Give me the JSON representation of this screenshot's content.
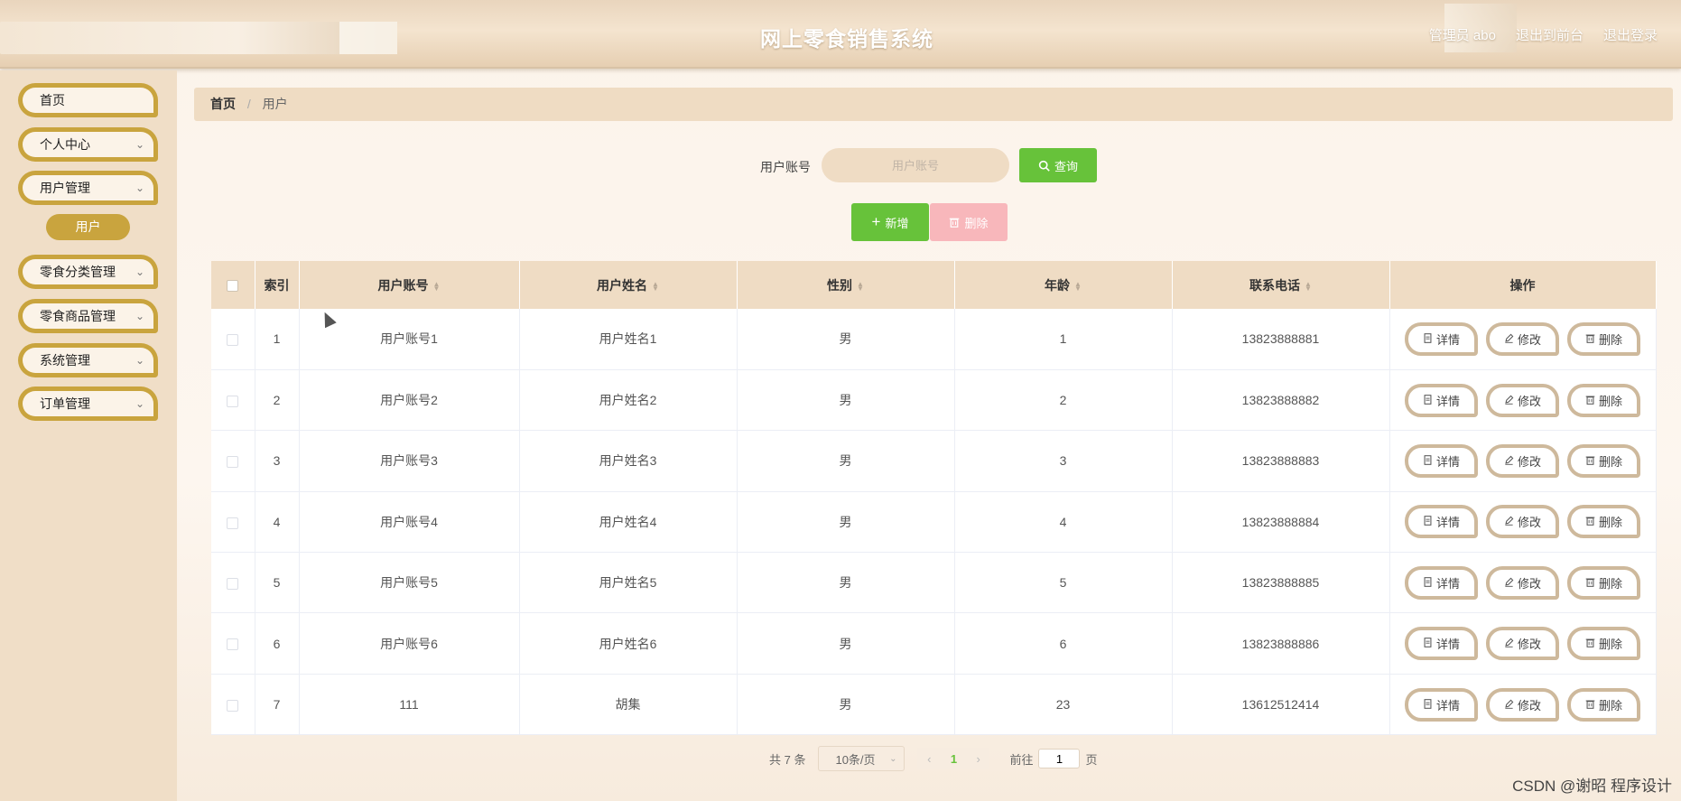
{
  "header": {
    "title": "网上零食销售系统",
    "links": [
      "管理员 abo",
      "退出到前台",
      "退出登录"
    ]
  },
  "sidebar": {
    "items": [
      {
        "label": "首页",
        "chevron": false
      },
      {
        "label": "个人中心",
        "chevron": true
      },
      {
        "label": "用户管理",
        "chevron": true
      },
      {
        "label": "零食分类管理",
        "chevron": true
      },
      {
        "label": "零食商品管理",
        "chevron": true
      },
      {
        "label": "系统管理",
        "chevron": true
      },
      {
        "label": "订单管理",
        "chevron": true
      }
    ],
    "active_sub": "用户"
  },
  "breadcrumb": {
    "home": "首页",
    "separator": "/",
    "current": "用户"
  },
  "search": {
    "label": "用户账号",
    "placeholder": "用户账号",
    "button": "查询",
    "add_button": "新增",
    "delete_button": "删除"
  },
  "table": {
    "columns": [
      "索引",
      "用户账号",
      "用户姓名",
      "性别",
      "年龄",
      "联系电话",
      "操作"
    ],
    "rows": [
      [
        "1",
        "用户账号1",
        "用户姓名1",
        "男",
        "1",
        "13823888881"
      ],
      [
        "2",
        "用户账号2",
        "用户姓名2",
        "男",
        "2",
        "13823888882"
      ],
      [
        "3",
        "用户账号3",
        "用户姓名3",
        "男",
        "3",
        "13823888883"
      ],
      [
        "4",
        "用户账号4",
        "用户姓名4",
        "男",
        "4",
        "13823888884"
      ],
      [
        "5",
        "用户账号5",
        "用户姓名5",
        "男",
        "5",
        "13823888885"
      ],
      [
        "6",
        "用户账号6",
        "用户姓名6",
        "男",
        "6",
        "13823888886"
      ],
      [
        "7",
        "111",
        "胡集",
        "男",
        "23",
        "13612512414"
      ]
    ],
    "row_actions": [
      "详情",
      "修改",
      "删除"
    ]
  },
  "pagination": {
    "total_text": "共 7 条",
    "page_size": "10条/页",
    "current_page": "1",
    "goto_prefix": "前往",
    "goto_value": "1",
    "goto_suffix": "页"
  },
  "watermark": "CSDN @谢昭  程序设计",
  "colors": {
    "accent_gold": "#c9a43e",
    "primary_green": "#67c23a",
    "danger_pink": "#f8b7bb",
    "header_beige": "#efdcc4"
  }
}
